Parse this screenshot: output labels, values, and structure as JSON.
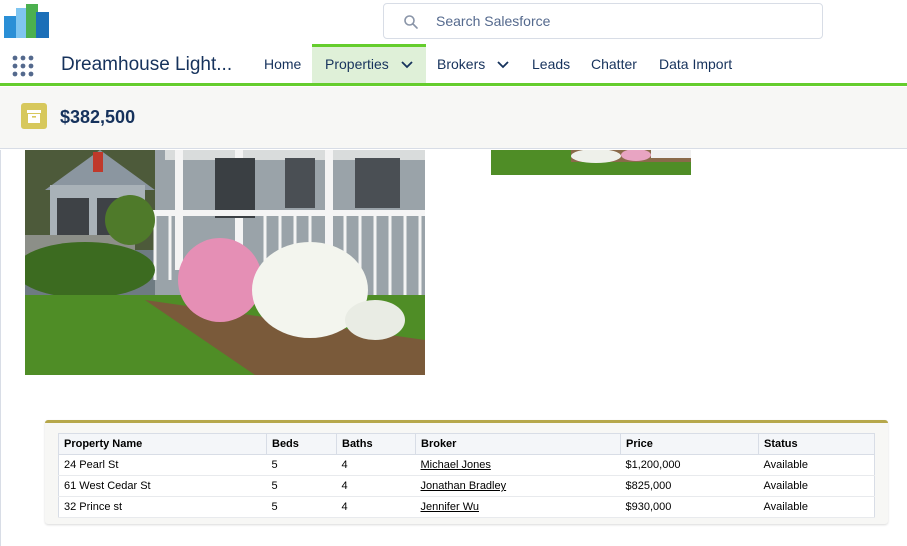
{
  "search": {
    "placeholder": "Search Salesforce"
  },
  "nav": {
    "app_name": "Dreamhouse Light...",
    "items": [
      {
        "label": "Home"
      },
      {
        "label": "Properties"
      },
      {
        "label": "Brokers"
      },
      {
        "label": "Leads"
      },
      {
        "label": "Chatter"
      },
      {
        "label": "Data Import"
      }
    ]
  },
  "record": {
    "title": "$382,500",
    "icon": "archive-box-icon",
    "icon_color": "#d7c85c"
  },
  "table": {
    "headers": [
      "Property Name",
      "Beds",
      "Baths",
      "Broker",
      "Price",
      "Status"
    ],
    "rows": [
      {
        "name": "24 Pearl St",
        "beds": "5",
        "baths": "4",
        "broker": "Michael Jones",
        "price": "$1,200,000",
        "status": "Available"
      },
      {
        "name": "61 West Cedar St",
        "beds": "5",
        "baths": "4",
        "broker": "Jonathan Bradley",
        "price": "$825,000",
        "status": "Available"
      },
      {
        "name": "32 Prince st",
        "beds": "5",
        "baths": "4",
        "broker": "Jennifer Wu",
        "price": "$930,000",
        "status": "Available"
      }
    ]
  },
  "colors": {
    "accent_green": "#65cd2d",
    "card_accent": "#b6a74a",
    "text": "#16325c"
  }
}
